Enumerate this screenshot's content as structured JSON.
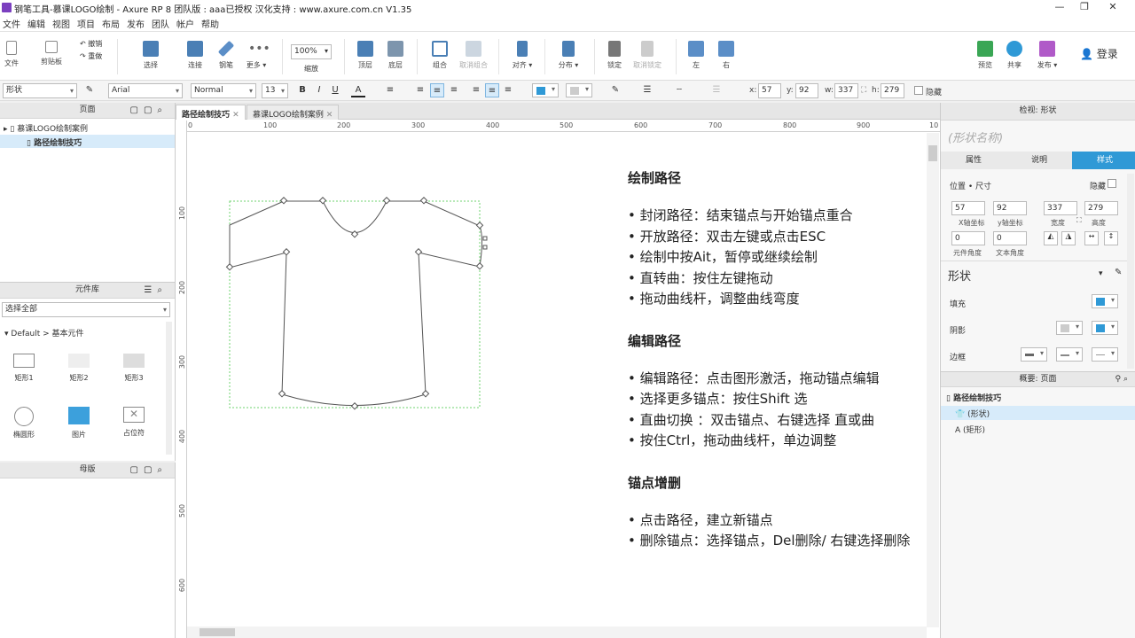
{
  "window": {
    "title": "钢笔工具-慕课LOGO绘制 - Axure RP 8 团队版 : aaa已授权 汉化支持 : www.axure.com.cn V1.35",
    "buttons": [
      "—",
      "❐",
      "✕"
    ]
  },
  "menu": [
    "文件",
    "编辑",
    "视图",
    "项目",
    "布局",
    "发布",
    "团队",
    "帐户",
    "帮助"
  ],
  "toolbar": {
    "file": "文件",
    "clipboard": "剪贴板",
    "undo": "撤销",
    "redo": "重做",
    "select": "选择",
    "connect": "连接",
    "pen": "钢笔",
    "more": "更多 ▾",
    "zoom_value": "100%",
    "zoom": "缩放",
    "top": "顶层",
    "bottom": "底层",
    "group": "组合",
    "ungroup": "取消组合",
    "align": "对齐 ▾",
    "distribute": "分布 ▾",
    "lock": "锁定",
    "unlock": "取消锁定",
    "left": "左",
    "right": "右",
    "preview": "预览",
    "share": "共享",
    "publish": "发布 ▾",
    "login": "登录"
  },
  "format": {
    "widget_type": "形状",
    "font": "Arial",
    "style": "Normal",
    "size": "13",
    "bold": "B",
    "italic": "I",
    "underline": "U",
    "text_color": "A",
    "x_label": "x:",
    "x": "57",
    "y_label": "y:",
    "y": "92",
    "w_label": "w:",
    "w": "337",
    "h_label": "h:",
    "h": "279",
    "hidden": "隐藏"
  },
  "pages_panel": {
    "title": "页面",
    "root": "慕课LOGO绘制案例",
    "child": "路径绘制技巧"
  },
  "library_panel": {
    "title": "元件库",
    "filter": "选择全部",
    "group": "Default > 基本元件",
    "widgets": [
      "矩形1",
      "矩形2",
      "矩形3",
      "椭圆形",
      "图片",
      "占位符"
    ]
  },
  "masters_panel": {
    "title": "母版"
  },
  "tabs": [
    {
      "label": "路径绘制技巧",
      "close": "✕"
    },
    {
      "label": "慕课LOGO绘制案例",
      "close": "✕"
    }
  ],
  "ruler": {
    "h": [
      "0",
      "100",
      "200",
      "300",
      "400",
      "500",
      "600",
      "700",
      "800",
      "900",
      "10"
    ],
    "v": [
      "100",
      "200",
      "300",
      "400",
      "500",
      "600"
    ]
  },
  "notes": {
    "s1_title": "绘制路径",
    "s1": [
      "• 封闭路径：结束锚点与开始锚点重合",
      "• 开放路径：双击左键或点击ESC",
      "• 绘制中按Ait，暂停或继续绘制",
      "• 直转曲：按住左键拖动",
      "• 拖动曲线杆，调整曲线弯度"
    ],
    "s2_title": "编辑路径",
    "s2": [
      "• 编辑路径：点击图形激活，拖动锚点编辑",
      "• 选择更多锚点：按住Shift 选",
      "• 直曲切换 ：双击锚点、右键选择 直或曲",
      "• 按住Ctrl，拖动曲线杆，单边调整"
    ],
    "s3_title": "锚点增删",
    "s3": [
      "• 点击路径，建立新锚点",
      "• 删除锚点：选择锚点，Del删除/ 右键选择删除"
    ]
  },
  "inspector": {
    "header": "检视: 形状",
    "name_placeholder": "(形状名称)",
    "tabs": [
      "属性",
      "说明",
      "样式"
    ],
    "pos_size": "位置 • 尺寸",
    "hidden": "隐藏",
    "x": "57",
    "y": "92",
    "w": "337",
    "h": "279",
    "x_label": "X轴坐标",
    "y_label": "y轴坐标",
    "w_label": "宽度",
    "h_label": "高度",
    "rot": "0",
    "text_rot": "0",
    "rot_label": "元件角度",
    "text_rot_label": "文本角度",
    "style_name": "形状",
    "fill": "填充",
    "shadow": "阴影",
    "border": "边框"
  },
  "outline": {
    "header": "概要: 页面",
    "page": "路径绘制技巧",
    "items": [
      "(形状)",
      "(矩形)"
    ]
  },
  "colors": {
    "accent": "#2f99d6",
    "selection": "#6fd36f"
  }
}
